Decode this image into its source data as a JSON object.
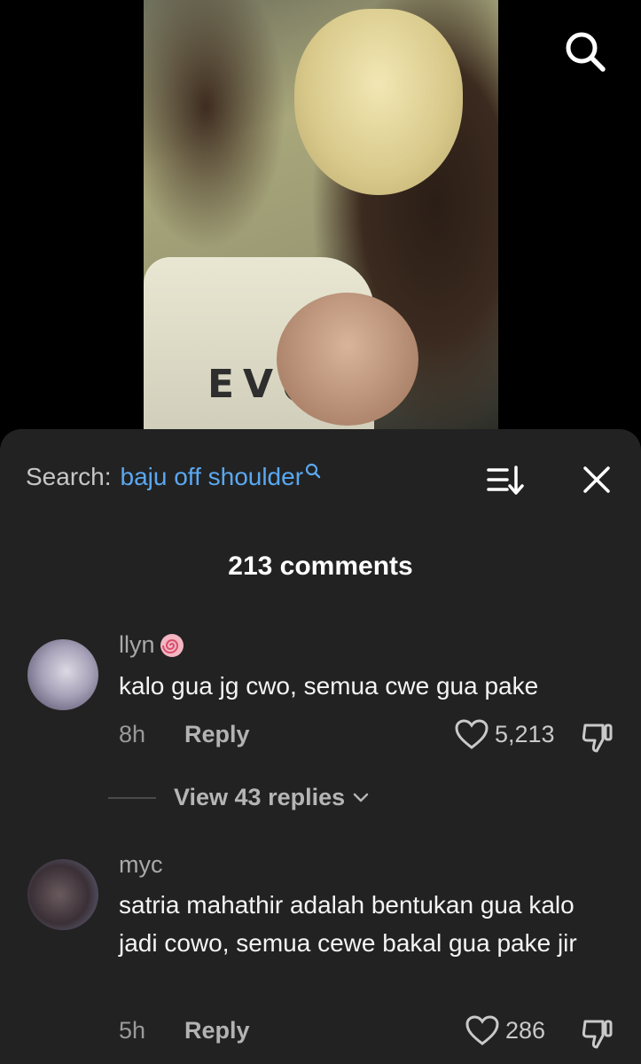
{
  "video": {
    "shirt_text": "EV●"
  },
  "sheet": {
    "search_label": "Search:",
    "search_term": "baju off shoulder",
    "comments_count": "213 comments",
    "view_replies": "View 43 replies"
  },
  "comments": [
    {
      "username": "llyn",
      "text": "kalo gua jg cwo, semua cwe gua pake",
      "time": "8h",
      "reply": "Reply",
      "likes": "5,213"
    },
    {
      "username": "myc",
      "text": "satria mahathir adalah bentukan gua kalo jadi cowo, semua cewe bakal gua pake jir",
      "time": "5h",
      "reply": "Reply",
      "likes": "286"
    }
  ],
  "icons": {
    "search": "search-icon",
    "sort": "sort-icon",
    "close": "close-icon",
    "heart": "heart-icon",
    "dislike": "thumbs-down-icon",
    "badge": "swirl-badge-icon",
    "chevron": "chevron-down-icon"
  },
  "colors": {
    "link": "#5aa8f2",
    "sheet_bg": "#222222"
  }
}
